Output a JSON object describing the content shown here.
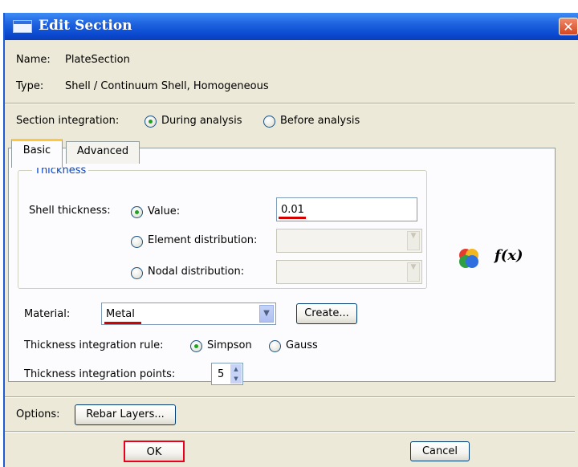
{
  "window": {
    "title": "Edit Section",
    "close_symbol": "✕"
  },
  "name_row": {
    "label": "Name:",
    "value": "PlateSection"
  },
  "type_row": {
    "label": "Type:",
    "value": "Shell / Continuum Shell, Homogeneous"
  },
  "section_integration": {
    "label": "Section integration:",
    "options": [
      "During analysis",
      "Before analysis"
    ],
    "selected": "During analysis"
  },
  "tabs": [
    {
      "label": "Basic",
      "active": true
    },
    {
      "label": "Advanced",
      "active": false
    }
  ],
  "thickness": {
    "group_title": "Thickness",
    "shell_thickness_label": "Shell thickness:",
    "value_option": "Value:",
    "value": "0.01",
    "element_distribution_option": "Element distribution:",
    "nodal_distribution_option": "Nodal distribution:",
    "selected": "Value:",
    "fx_label": "f(x)"
  },
  "material": {
    "label": "Material:",
    "value": "Metal",
    "create_button": "Create..."
  },
  "integration_rule": {
    "label": "Thickness integration rule:",
    "options": [
      "Simpson",
      "Gauss"
    ],
    "selected": "Simpson"
  },
  "integration_points": {
    "label": "Thickness integration points:",
    "value": "5"
  },
  "options": {
    "label": "Options:",
    "rebar_button": "Rebar Layers..."
  },
  "footer": {
    "ok_label": "OK",
    "cancel_label": "Cancel"
  },
  "colors": {
    "title_bar": "#0a49d0",
    "dialog_bg": "#ece9d8",
    "group_title": "#0046d5",
    "highlight": "#d40000",
    "radio_dot": "#21a121"
  }
}
